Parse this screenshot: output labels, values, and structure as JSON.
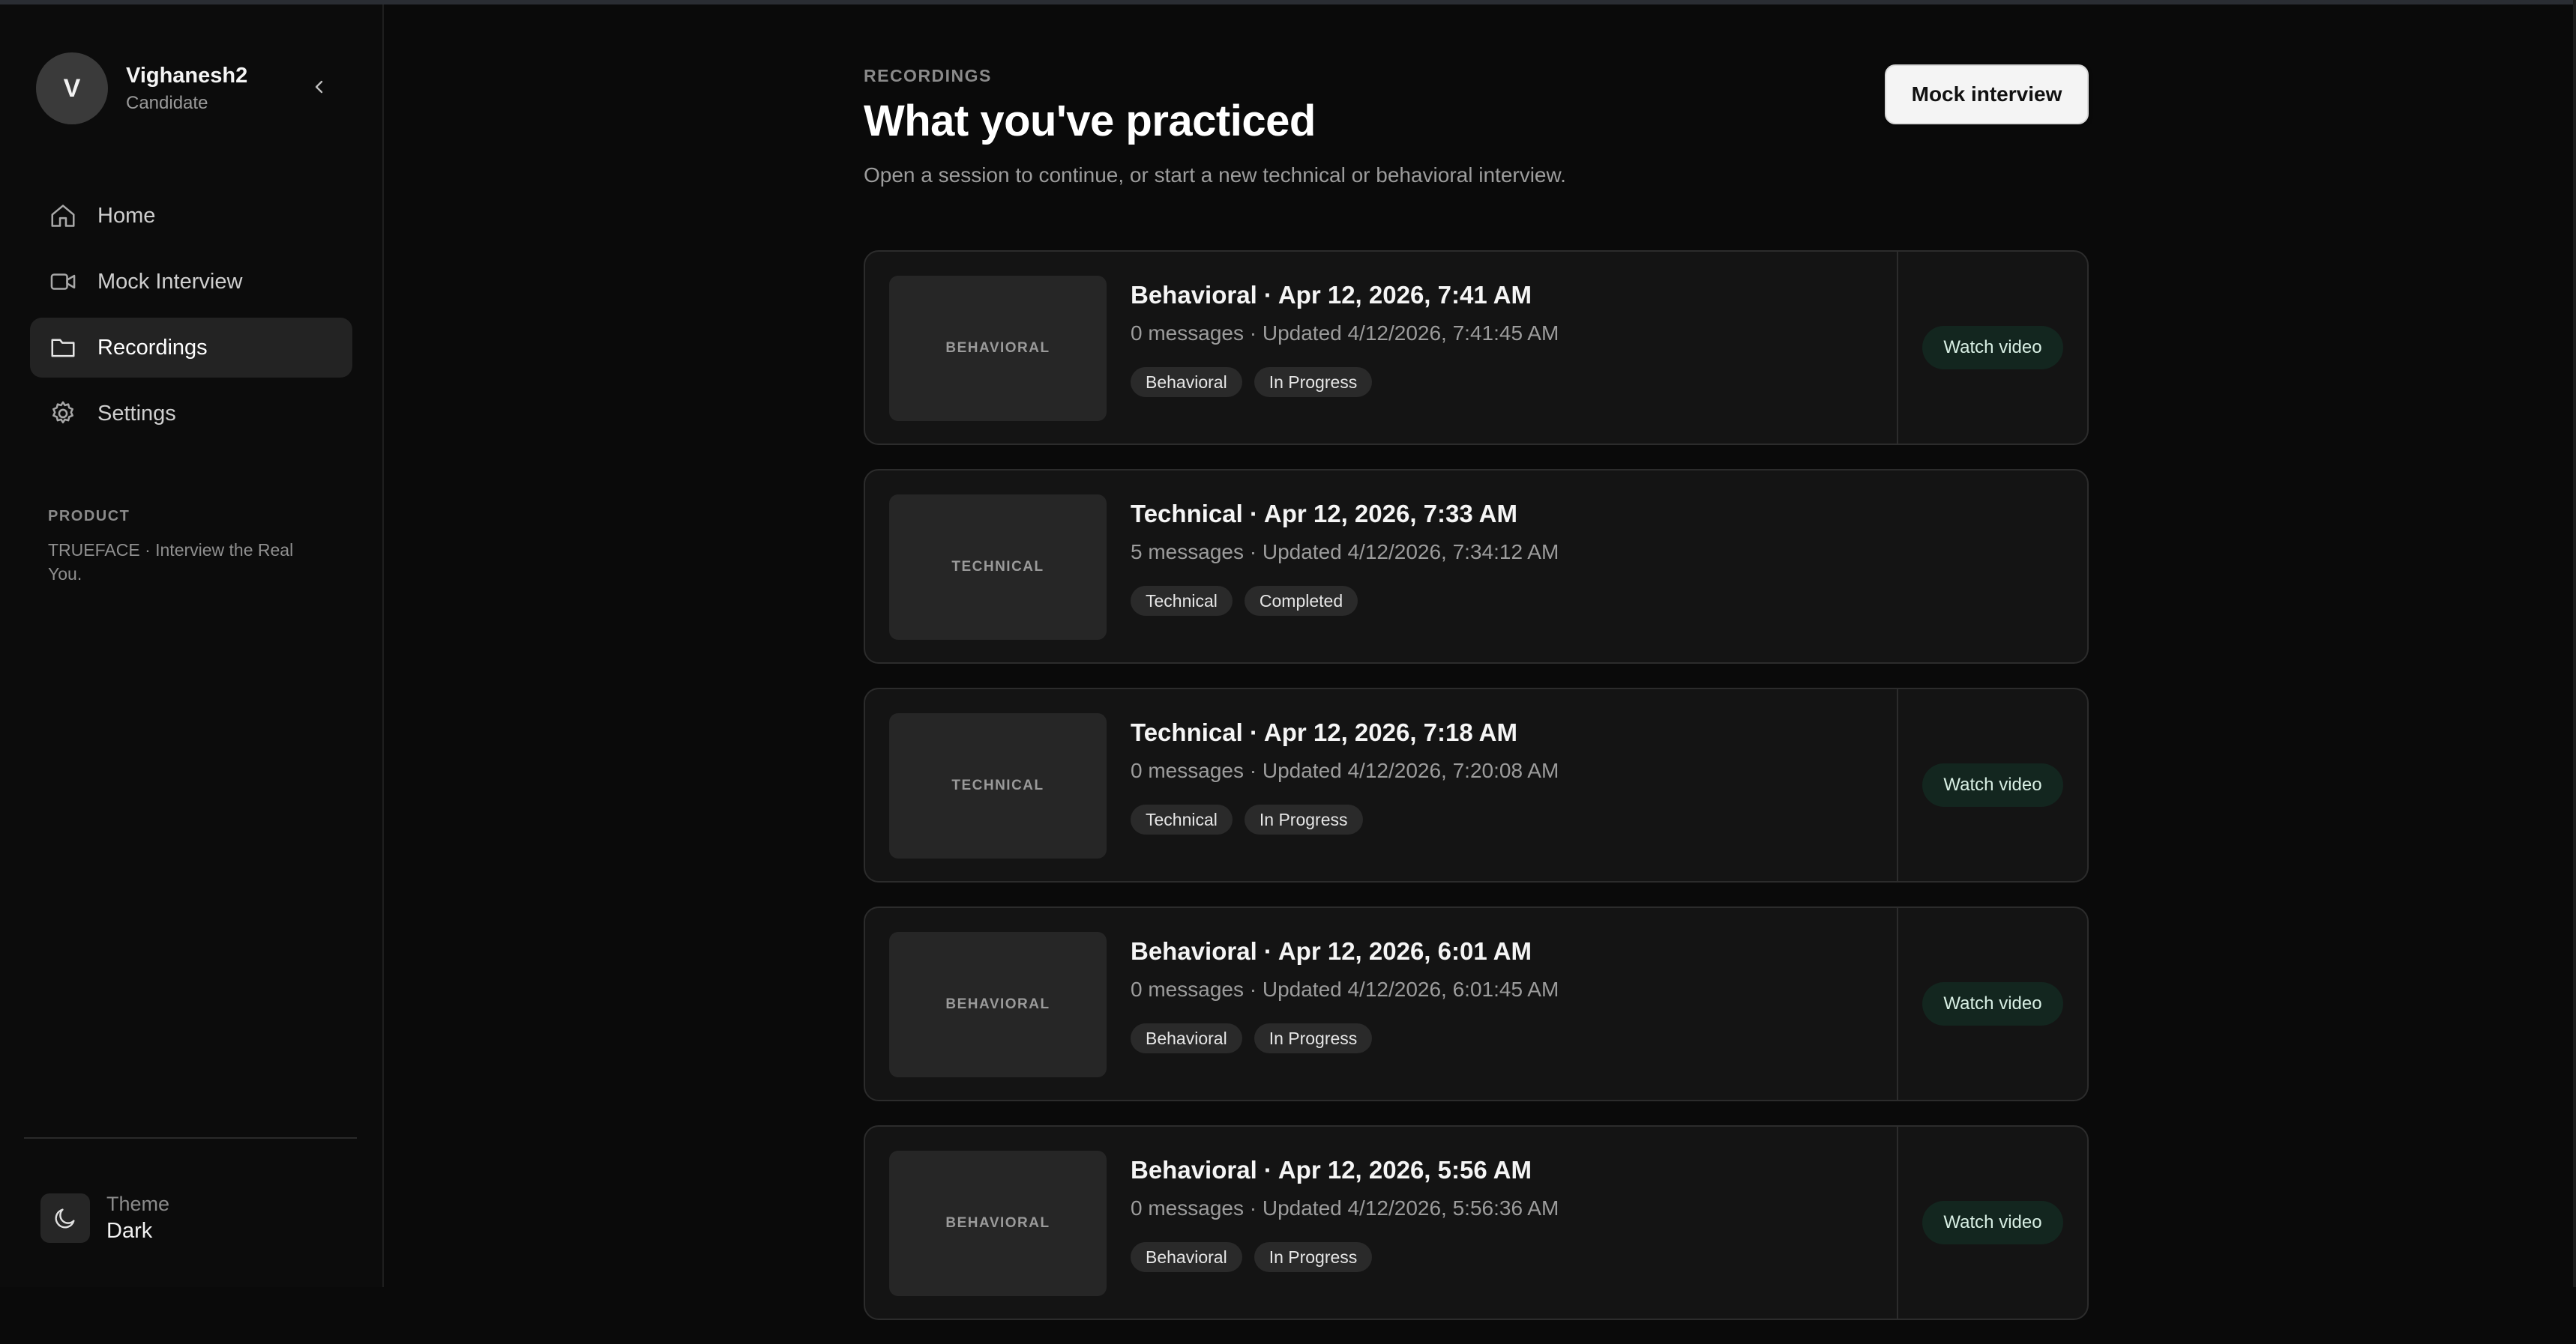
{
  "sidebar": {
    "user": {
      "initial": "V",
      "name": "Vighanesh2",
      "role": "Candidate"
    },
    "nav": [
      {
        "label": "Home",
        "icon": "home-icon"
      },
      {
        "label": "Mock Interview",
        "icon": "video-icon"
      },
      {
        "label": "Recordings",
        "icon": "folder-icon",
        "active": true
      },
      {
        "label": "Settings",
        "icon": "gear-icon"
      }
    ],
    "product_heading": "PRODUCT",
    "product_text": "TRUEFACE · Interview the Real You.",
    "theme": {
      "label": "Theme",
      "value": "Dark",
      "icon": "moon-icon"
    }
  },
  "main": {
    "eyebrow": "RECORDINGS",
    "title": "What you've practiced",
    "subtitle": "Open a session to continue, or start a new technical or behavioral interview.",
    "primary_button": "Mock interview",
    "sessions": [
      {
        "thumb": "BEHAVIORAL",
        "title": "Behavioral · Apr 12, 2026, 7:41 AM",
        "meta": "0 messages · Updated 4/12/2026, 7:41:45 AM",
        "tags": [
          "Behavioral",
          "In Progress"
        ],
        "action": "Watch video"
      },
      {
        "thumb": "TECHNICAL",
        "title": "Technical · Apr 12, 2026, 7:33 AM",
        "meta": "5 messages · Updated 4/12/2026, 7:34:12 AM",
        "tags": [
          "Technical",
          "Completed"
        ],
        "action": ""
      },
      {
        "thumb": "TECHNICAL",
        "title": "Technical · Apr 12, 2026, 7:18 AM",
        "meta": "0 messages · Updated 4/12/2026, 7:20:08 AM",
        "tags": [
          "Technical",
          "In Progress"
        ],
        "action": "Watch video"
      },
      {
        "thumb": "BEHAVIORAL",
        "title": "Behavioral · Apr 12, 2026, 6:01 AM",
        "meta": "0 messages · Updated 4/12/2026, 6:01:45 AM",
        "tags": [
          "Behavioral",
          "In Progress"
        ],
        "action": "Watch video"
      },
      {
        "thumb": "BEHAVIORAL",
        "title": "Behavioral · Apr 12, 2026, 5:56 AM",
        "meta": "0 messages · Updated 4/12/2026, 5:56:36 AM",
        "tags": [
          "Behavioral",
          "In Progress"
        ],
        "action": "Watch video"
      }
    ]
  },
  "colors": {
    "background": "#0a0a0a",
    "sidebar": "#0c0c0c",
    "card": "#141414",
    "active_nav": "#232323",
    "watch_button": "#13261f"
  }
}
